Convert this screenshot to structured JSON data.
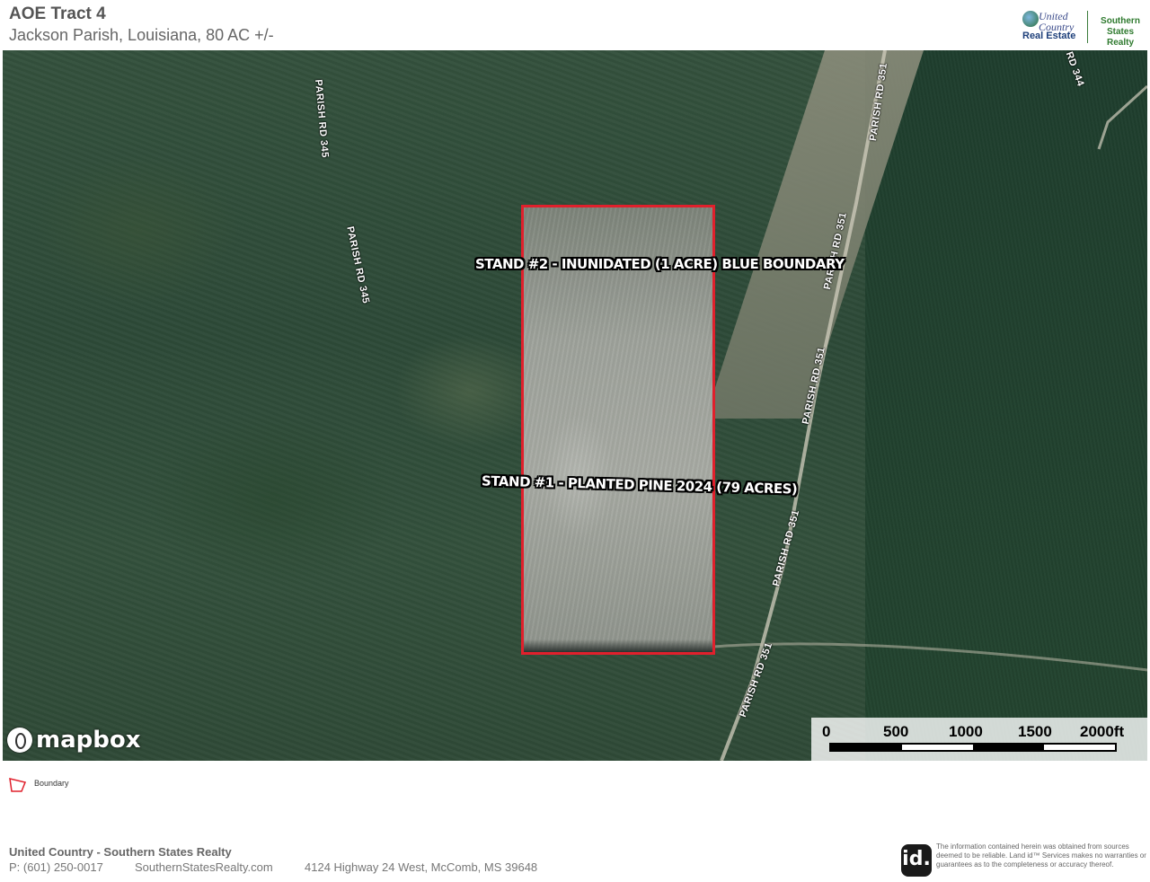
{
  "header": {
    "title": "AOE Tract 4",
    "subtitle": "Jackson Parish, Louisiana, 80 AC +/-"
  },
  "logo": {
    "united_country": "United Country",
    "real_estate": "Real Estate",
    "brand": "Southern States Realty"
  },
  "map": {
    "road_labels": [
      "PARISH RD 345",
      "PARISH RD 345",
      "PARISH RD 351",
      "PARISH RD 351",
      "PARISH RD 351",
      "PARISH RD 351",
      "PARISH RD 351",
      "RD 344"
    ],
    "stand_labels": [
      "STAND #2 - INUNIDATED (1 ACRE) BLUE BOUNDARY",
      "STAND #1 - PLANTED PINE 2024 (79 ACRES)"
    ],
    "attribution": "mapbox",
    "scale_ticks": [
      "0",
      "500",
      "1000",
      "1500",
      "2000ft"
    ],
    "boundary_color": "#e0202c"
  },
  "legend": {
    "label": "Boundary"
  },
  "footer": {
    "company": "United Country - Southern States Realty",
    "phone": "P: (601) 250-0017",
    "website": "SouthernStatesRealty.com",
    "address": "4124 Highway 24 West, McComb, MS 39648",
    "id_logo": "id.",
    "disclaimer": "The information contained herein was obtained from sources deemed to be reliable. Land id™ Services makes no warranties or guarantees as to the completeness or accuracy thereof."
  }
}
